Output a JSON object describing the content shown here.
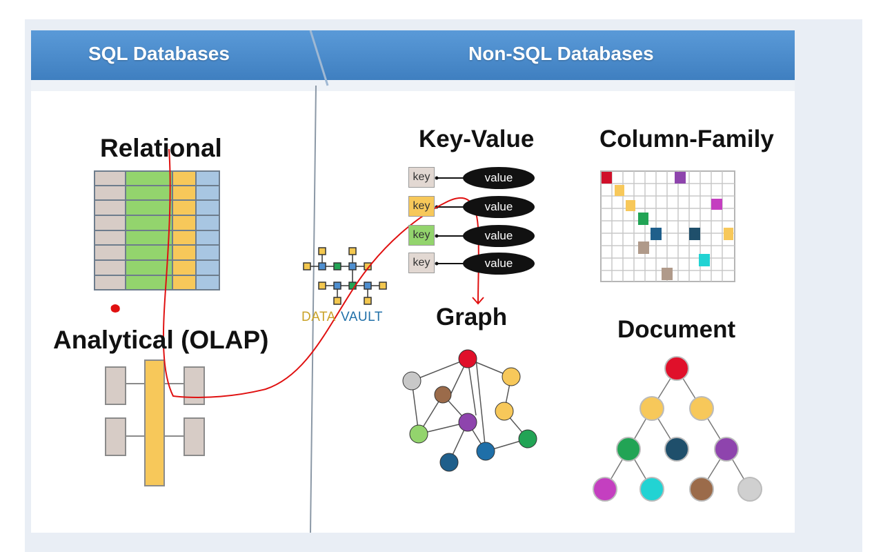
{
  "slide": {
    "sql_header": "SQL Databases",
    "nosql_header": "Non-SQL Databases",
    "relational_label": "Relational",
    "olap_label": "Analytical (OLAP)",
    "keyvalue_label": "Key-Value",
    "columnfamily_label": "Column-Family",
    "graph_label": "Graph",
    "document_label": "Document",
    "kv_rows": [
      {
        "key": "key",
        "value": "value"
      },
      {
        "key": "key",
        "value": "value"
      },
      {
        "key": "key",
        "value": "value"
      },
      {
        "key": "key",
        "value": "value"
      }
    ],
    "logo": {
      "part1": "DATA",
      "part2": "VAULT"
    }
  },
  "colors": {
    "header_blue": "#4f8fd0",
    "relational_green": "#93d46d",
    "relational_yellow": "#f7c85a",
    "relational_blue": "#a8c6e2",
    "relational_gray": "#d7ccc6",
    "annotation_red": "#e01010",
    "logo_gold": "#c9a227",
    "logo_blue": "#1f6fa8"
  }
}
